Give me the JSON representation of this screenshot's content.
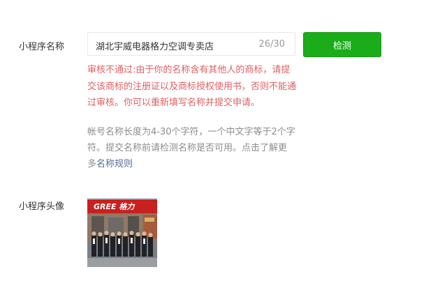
{
  "form": {
    "name_label": "小程序名称",
    "name_value": "湖北宇威电器格力空调专卖店",
    "char_count": "26/30",
    "check_button": "检测",
    "error_message": "审核不通过:由于你的名称含有其他人的商标，请提交该商标的注册证以及商标授权使用书，否则不能通过审核。你可以重新填写名称并提交申请。",
    "hint_text": "帐号名称长度为4-30个字符，一个中文字等于2个字符。提交名称前请检测名称是否可用。点击了解更多",
    "hint_link": "名称规则",
    "avatar_label": "小程序头像"
  },
  "avatar_image": {
    "icon": "avatar-photo",
    "logo_text": "GREE 格力"
  },
  "colors": {
    "primary_button": "#1aad19",
    "error": "#e15f63",
    "link": "#576b95",
    "hint": "#8d8d8d"
  }
}
